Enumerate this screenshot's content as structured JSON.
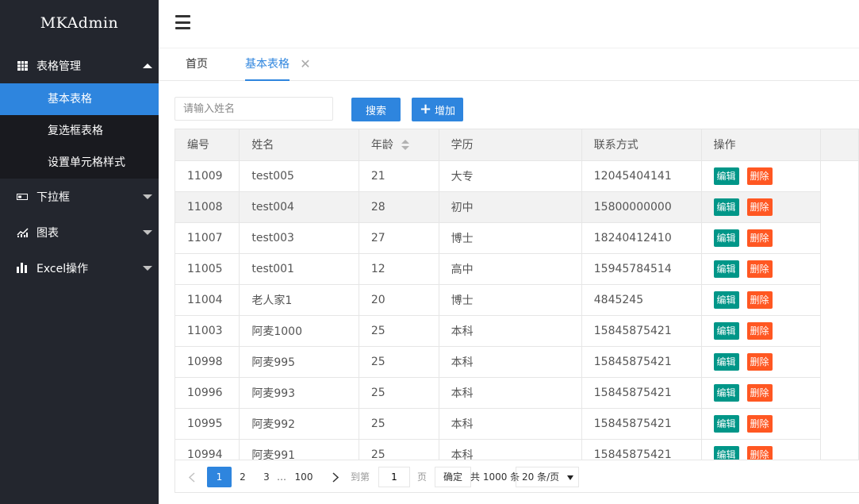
{
  "app": {
    "title": "MKAdmin"
  },
  "sidebar": {
    "groups": [
      {
        "label": "表格管理",
        "icon": "table-icon",
        "expanded": true,
        "children": [
          {
            "label": "基本表格",
            "active": true
          },
          {
            "label": "复选框表格",
            "active": false
          },
          {
            "label": "设置单元格样式",
            "active": false
          }
        ]
      },
      {
        "label": "下拉框",
        "icon": "dropdown-icon",
        "expanded": false
      },
      {
        "label": "图表",
        "icon": "chart-icon",
        "expanded": false
      },
      {
        "label": "Excel操作",
        "icon": "bar-chart-icon",
        "expanded": false
      }
    ]
  },
  "tabs": [
    {
      "label": "首页",
      "active": false
    },
    {
      "label": "基本表格",
      "active": true,
      "closable": true
    }
  ],
  "toolbar": {
    "search_placeholder": "请输入姓名",
    "search_label": "搜索",
    "add_label": "增加"
  },
  "table": {
    "columns": [
      "编号",
      "姓名",
      "年龄",
      "学历",
      "联系方式",
      "操作"
    ],
    "edit_label": "编辑",
    "delete_label": "删除",
    "rows": [
      [
        "11009",
        "test005",
        "21",
        "大专",
        "12045404141"
      ],
      [
        "11008",
        "test004",
        "28",
        "初中",
        "15800000000"
      ],
      [
        "11007",
        "test003",
        "27",
        "博士",
        "18240412410"
      ],
      [
        "11005",
        "test001",
        "12",
        "高中",
        "15945784514"
      ],
      [
        "11004",
        "老人家1",
        "20",
        "博士",
        "4845245"
      ],
      [
        "11003",
        "阿麦1000",
        "25",
        "本科",
        "15845875421"
      ],
      [
        "10998",
        "阿麦995",
        "25",
        "本科",
        "15845875421"
      ],
      [
        "10996",
        "阿麦993",
        "25",
        "本科",
        "15845875421"
      ],
      [
        "10995",
        "阿麦992",
        "25",
        "本科",
        "15845875421"
      ],
      [
        "10994",
        "阿麦991",
        "25",
        "本科",
        "15845875421"
      ]
    ],
    "highlighted_row": 1
  },
  "pagination": {
    "pages": [
      "1",
      "2",
      "3",
      "…",
      "100"
    ],
    "current": "1",
    "goto_label": "到第",
    "goto_value": "1",
    "page_unit": "页",
    "confirm_label": "确定",
    "total_label": "共 1000 条",
    "page_size": "20 条/页"
  }
}
